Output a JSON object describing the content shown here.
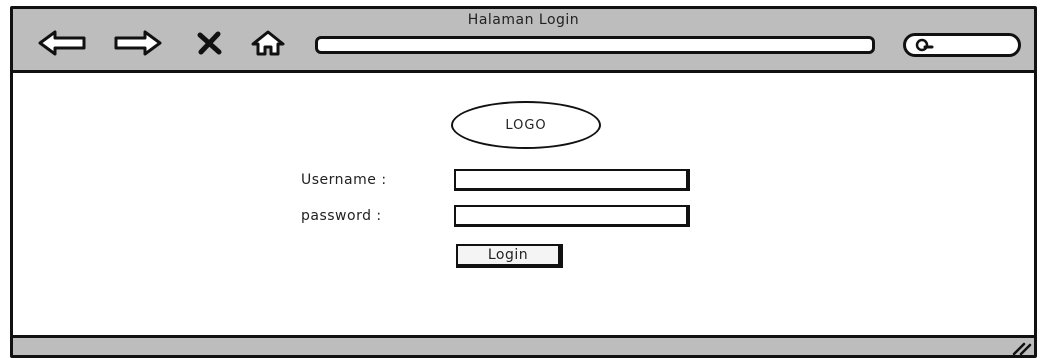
{
  "window": {
    "title": "Halaman Login"
  },
  "toolbar": {
    "icons": [
      "back-arrow-icon",
      "forward-arrow-icon",
      "close-x-icon",
      "home-icon"
    ],
    "address_value": "",
    "search_icon": "search-icon",
    "search_value": ""
  },
  "login_form": {
    "logo_text": "LOGO",
    "username_label": "Username :",
    "username_value": "",
    "password_label": "password :",
    "password_value": "",
    "login_button_label": "Login"
  },
  "colors": {
    "toolbar_bg": "#bdbdbd",
    "border": "#111111",
    "content_bg": "#ffffff"
  }
}
